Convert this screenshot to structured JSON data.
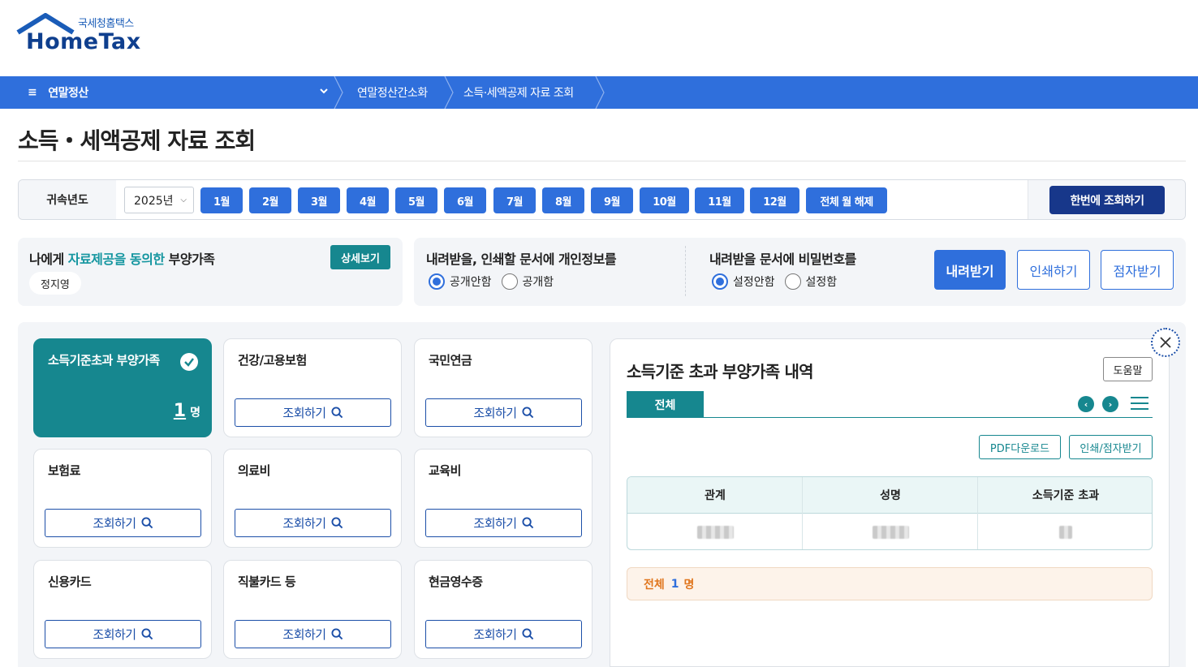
{
  "logo": {
    "subtitle": "국세청홈택스",
    "title": "HomeTax"
  },
  "nav": {
    "menu_label": "연말정산",
    "breadcrumbs": [
      "연말정산간소화",
      "소득·세액공제 자료 조회"
    ]
  },
  "page_title": "소득・세액공제 자료 조회",
  "month_bar": {
    "label": "귀속년도",
    "year": "2025년",
    "months": [
      "1월",
      "2월",
      "3월",
      "4월",
      "5월",
      "6월",
      "7월",
      "8월",
      "9월",
      "10월",
      "11월",
      "12월"
    ],
    "clear_all": "전체 월 해제",
    "query_all": "한번에 조회하기"
  },
  "dependents": {
    "title_prefix": "나에게 ",
    "title_highlight": "자료제공을 동의한",
    "title_suffix": " 부양가족",
    "detail_button": "상세보기",
    "name": "정지영"
  },
  "print_options": {
    "privacy_title": "내려받을, 인쇄할 문서에 개인정보를",
    "privacy_options": [
      {
        "label": "공개안함",
        "selected": true
      },
      {
        "label": "공개함",
        "selected": false
      }
    ],
    "password_title": "내려받을 문서에 비밀번호를",
    "password_options": [
      {
        "label": "설정안함",
        "selected": true
      },
      {
        "label": "설정함",
        "selected": false
      }
    ],
    "download": "내려받기",
    "print": "인쇄하기",
    "braille": "점자받기"
  },
  "cards": [
    {
      "title": "소득기준초과 부양가족",
      "active": true,
      "count": "1",
      "unit": "명"
    },
    {
      "title": "건강/고용보험",
      "button": "조회하기"
    },
    {
      "title": "국민연금",
      "button": "조회하기"
    },
    {
      "title": "보험료",
      "button": "조회하기"
    },
    {
      "title": "의료비",
      "button": "조회하기"
    },
    {
      "title": "교육비",
      "button": "조회하기"
    },
    {
      "title": "신용카드",
      "button": "조회하기"
    },
    {
      "title": "직불카드 등",
      "button": "조회하기"
    },
    {
      "title": "현금영수증",
      "button": "조회하기"
    }
  ],
  "detail": {
    "title": "소득기준 초과 부양가족 내역",
    "help": "도움말",
    "tab": "전체",
    "pdf_download": "PDF다운로드",
    "print_braille": "인쇄/점자받기",
    "columns": [
      "관계",
      "성명",
      "소득기준 초과"
    ],
    "total_label": "전체",
    "total_count": "1",
    "total_unit": "명"
  },
  "colors": {
    "primary": "#2f6fdc",
    "navy": "#17378a",
    "teal": "#16878f",
    "orange": "#e0761e"
  },
  "icons": [
    "hamburger-icon",
    "chevron-down-icon",
    "check-icon",
    "search-icon",
    "close-icon",
    "arrow-left-icon",
    "arrow-right-icon",
    "menu-icon"
  ]
}
